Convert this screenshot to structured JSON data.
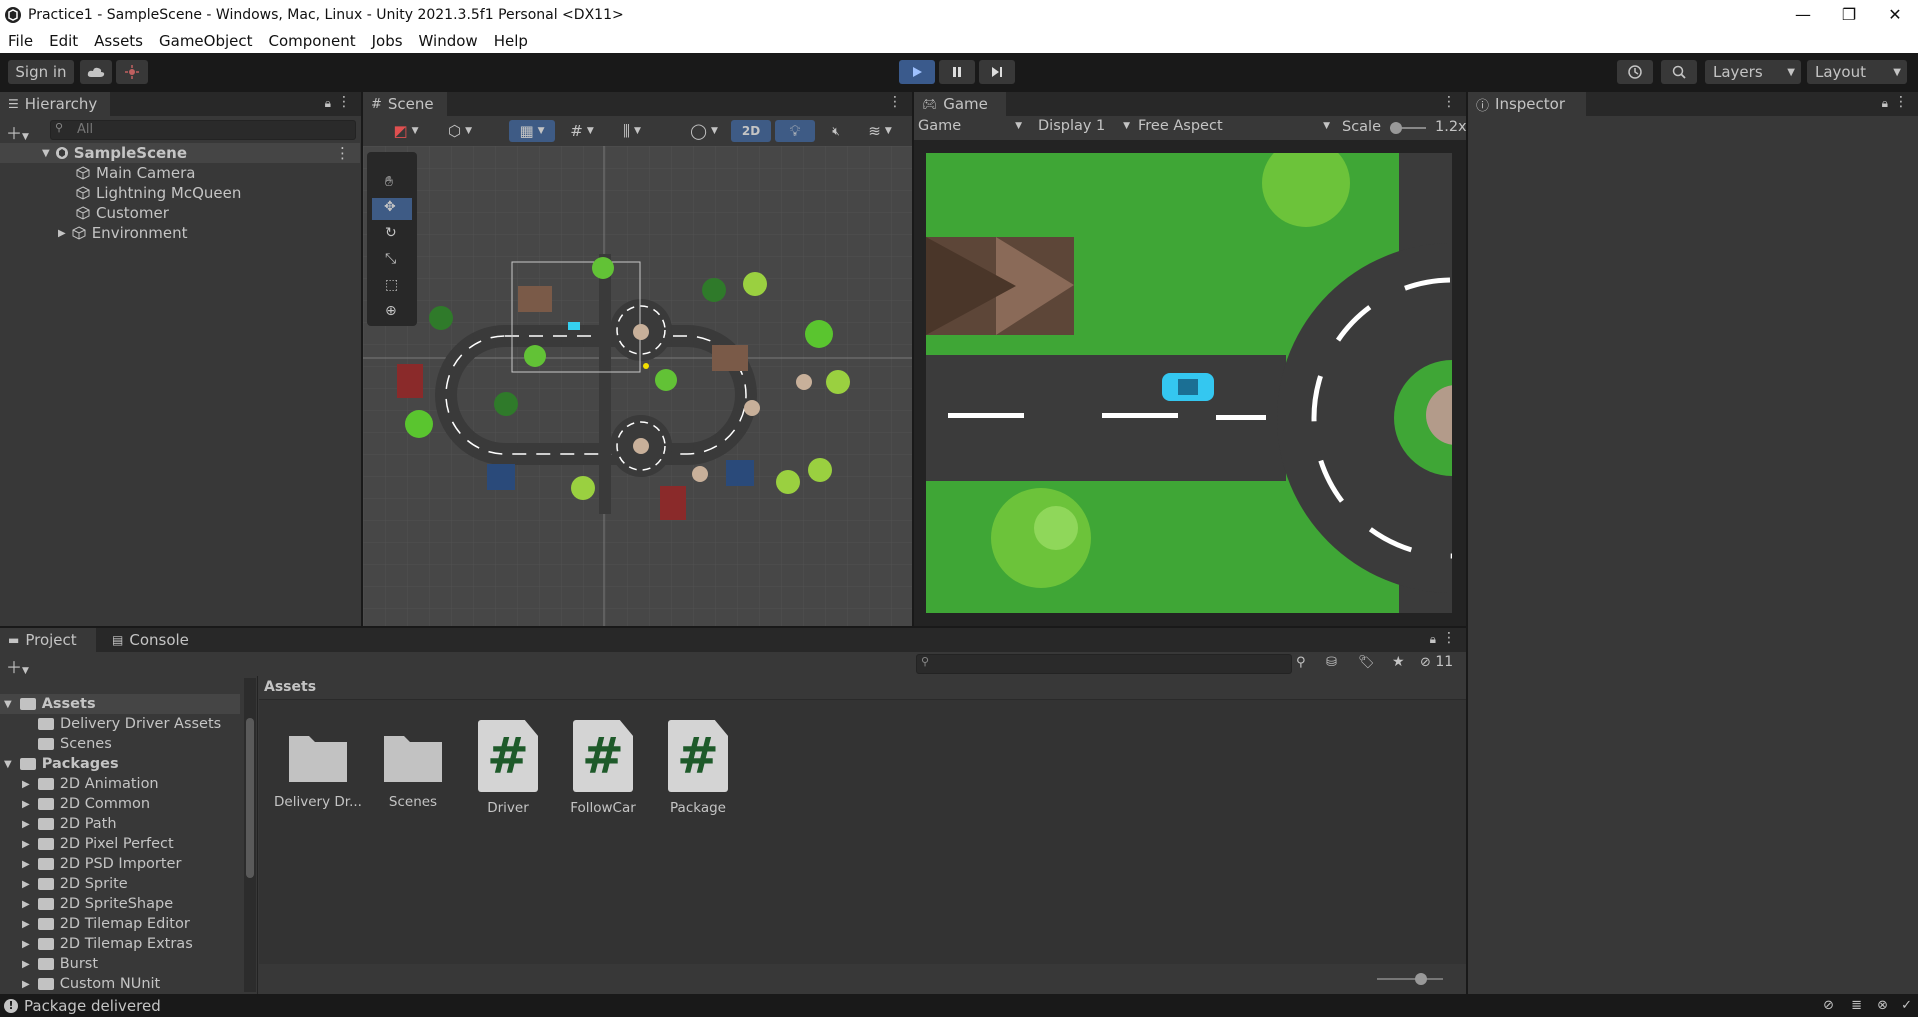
{
  "window": {
    "title": "Practice1 - SampleScene - Windows, Mac, Linux - Unity 2021.3.5f1 Personal <DX11>"
  },
  "menu": [
    "File",
    "Edit",
    "Assets",
    "GameObject",
    "Component",
    "Jobs",
    "Window",
    "Help"
  ],
  "toolbar": {
    "sign_in": "Sign in",
    "layers": "Layers",
    "layout": "Layout"
  },
  "hierarchy": {
    "tab": "Hierarchy",
    "search_placeholder": "All",
    "scene": "SampleScene",
    "objects": [
      "Main Camera",
      "Lightning McQueen",
      "Customer",
      "Environment"
    ]
  },
  "scene": {
    "tab": "Scene",
    "mode_2d": "2D"
  },
  "game": {
    "tab": "Game",
    "view": "Game",
    "display": "Display 1",
    "aspect": "Free Aspect",
    "scale_label": "Scale",
    "scale_value": "1.2x"
  },
  "inspector": {
    "tab": "Inspector"
  },
  "project": {
    "tab_project": "Project",
    "tab_console": "Console",
    "hidden_count": "11",
    "breadcrumb": "Assets",
    "tree": [
      {
        "label": "Assets",
        "level": 0,
        "bold": true,
        "expanded": true
      },
      {
        "label": "Delivery Driver Assets",
        "level": 1
      },
      {
        "label": "Scenes",
        "level": 1
      },
      {
        "label": "Packages",
        "level": 0,
        "bold": true,
        "expanded": true
      },
      {
        "label": "2D Animation",
        "level": 1
      },
      {
        "label": "2D Common",
        "level": 1
      },
      {
        "label": "2D Path",
        "level": 1
      },
      {
        "label": "2D Pixel Perfect",
        "level": 1
      },
      {
        "label": "2D PSD Importer",
        "level": 1
      },
      {
        "label": "2D Sprite",
        "level": 1
      },
      {
        "label": "2D SpriteShape",
        "level": 1
      },
      {
        "label": "2D Tilemap Editor",
        "level": 1
      },
      {
        "label": "2D Tilemap Extras",
        "level": 1
      },
      {
        "label": "Burst",
        "level": 1
      },
      {
        "label": "Custom NUnit",
        "level": 1
      }
    ],
    "assets": [
      {
        "name": "Delivery Dr...",
        "kind": "folder"
      },
      {
        "name": "Scenes",
        "kind": "folder"
      },
      {
        "name": "Driver",
        "kind": "script"
      },
      {
        "name": "FollowCar",
        "kind": "script"
      },
      {
        "name": "Package",
        "kind": "script"
      }
    ]
  },
  "status": {
    "message": "Package delivered"
  }
}
